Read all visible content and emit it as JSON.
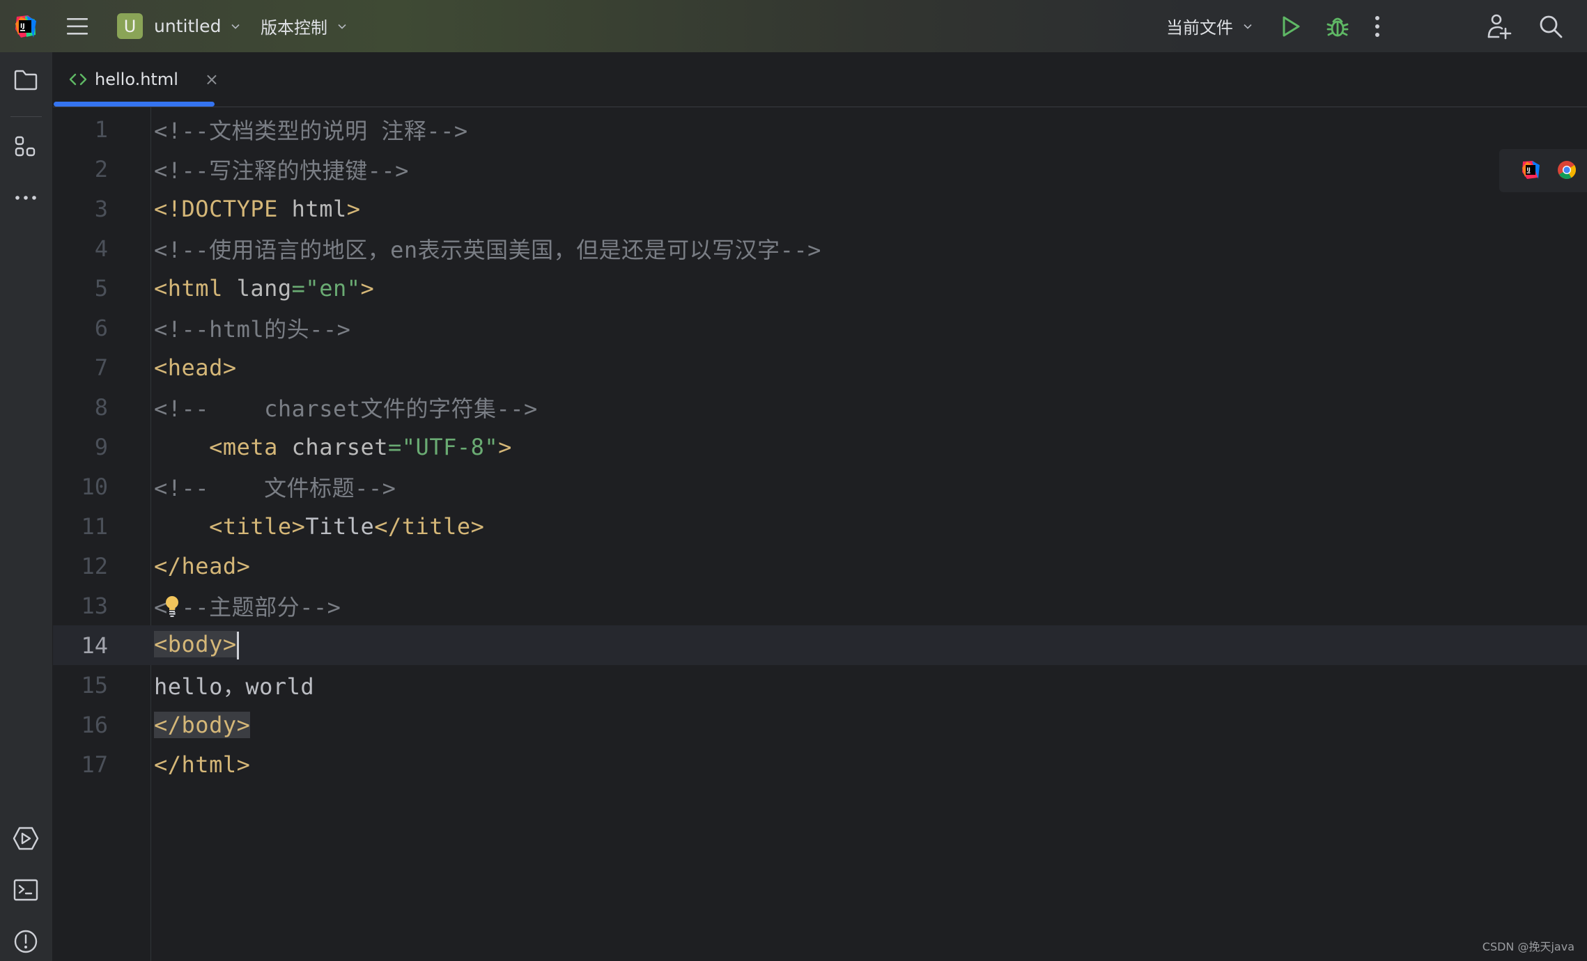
{
  "titlebar": {
    "project_initial": "U",
    "project_name": "untitled",
    "vcs_label": "版本控制",
    "run_config_label": "当前文件",
    "icons": {
      "app": "intellij-logo-icon",
      "menu": "hamburger-menu-icon",
      "run": "run-play-icon",
      "debug": "debug-bug-icon",
      "more": "more-vertical-icon",
      "add_user": "add-user-icon",
      "search": "search-icon"
    },
    "accent_run": "#5fb865"
  },
  "toolstrip": {
    "top": [
      "project-folder-icon",
      "structure-icon",
      "more-horizontal-icon"
    ],
    "bottom": [
      "services-run-icon",
      "terminal-icon",
      "problems-icon"
    ]
  },
  "tabs": [
    {
      "label": "hello.html",
      "icon": "html-code-icon",
      "active": true,
      "close": "×"
    }
  ],
  "editor": {
    "current_line": 14,
    "lines": [
      {
        "n": "1",
        "tokens": [
          {
            "t": "<!--文档类型的说明 注释-->",
            "c": "c-comment"
          }
        ]
      },
      {
        "n": "2",
        "tokens": [
          {
            "t": "<!--写注释的快捷键-->",
            "c": "c-comment"
          }
        ]
      },
      {
        "n": "3",
        "tokens": [
          {
            "t": "<!DOCTYPE ",
            "c": "c-tag"
          },
          {
            "t": "html",
            "c": "c-attr"
          },
          {
            "t": ">",
            "c": "c-tag"
          }
        ]
      },
      {
        "n": "4",
        "tokens": [
          {
            "t": "<!--使用语言的地区，en表示英国美国，但是还是可以写汉字-->",
            "c": "c-comment"
          }
        ]
      },
      {
        "n": "5",
        "tokens": [
          {
            "t": "<html ",
            "c": "c-tag"
          },
          {
            "t": "lang",
            "c": "c-attr"
          },
          {
            "t": "=\"en\"",
            "c": "c-str"
          },
          {
            "t": ">",
            "c": "c-tag"
          }
        ]
      },
      {
        "n": "6",
        "tokens": [
          {
            "t": "<!--html的头-->",
            "c": "c-comment"
          }
        ]
      },
      {
        "n": "7",
        "tokens": [
          {
            "t": "<head>",
            "c": "c-tag"
          }
        ]
      },
      {
        "n": "8",
        "tokens": [
          {
            "t": "<!--    charset文件的字符集-->",
            "c": "c-comment"
          }
        ]
      },
      {
        "n": "9",
        "tokens": [
          {
            "t": "    ",
            "c": "c-text"
          },
          {
            "t": "<meta ",
            "c": "c-tag"
          },
          {
            "t": "charset",
            "c": "c-attr"
          },
          {
            "t": "=\"UTF-8\"",
            "c": "c-str"
          },
          {
            "t": ">",
            "c": "c-tag"
          }
        ]
      },
      {
        "n": "10",
        "tokens": [
          {
            "t": "<!--    文件标题-->",
            "c": "c-comment"
          }
        ]
      },
      {
        "n": "11",
        "tokens": [
          {
            "t": "    ",
            "c": "c-text"
          },
          {
            "t": "<title>",
            "c": "c-tag"
          },
          {
            "t": "Title",
            "c": "c-text"
          },
          {
            "t": "</title>",
            "c": "c-tag"
          }
        ]
      },
      {
        "n": "12",
        "tokens": [
          {
            "t": "</head>",
            "c": "c-tag"
          }
        ]
      },
      {
        "n": "13",
        "tokens": [
          {
            "t": "<!--主题部分-->",
            "c": "c-comment"
          }
        ]
      },
      {
        "n": "14",
        "tokens": [
          {
            "t": "<body>",
            "c": "c-tag hl"
          }
        ]
      },
      {
        "n": "15",
        "tokens": [
          {
            "t": "hello，world",
            "c": "c-text"
          }
        ]
      },
      {
        "n": "16",
        "tokens": [
          {
            "t": "</body>",
            "c": "c-tag hl"
          }
        ]
      },
      {
        "n": "17",
        "tokens": [
          {
            "t": "</html>",
            "c": "c-tag"
          }
        ]
      }
    ],
    "intention_bulb_line": 13,
    "syntax_colors": {
      "comment": "#7a7e85",
      "tag": "#d5b778",
      "string": "#6aab73",
      "text": "#bcbec4"
    }
  },
  "browser_bar": [
    "intellij-browser-icon",
    "chrome-browser-icon"
  ],
  "watermark": "CSDN @挽天java"
}
